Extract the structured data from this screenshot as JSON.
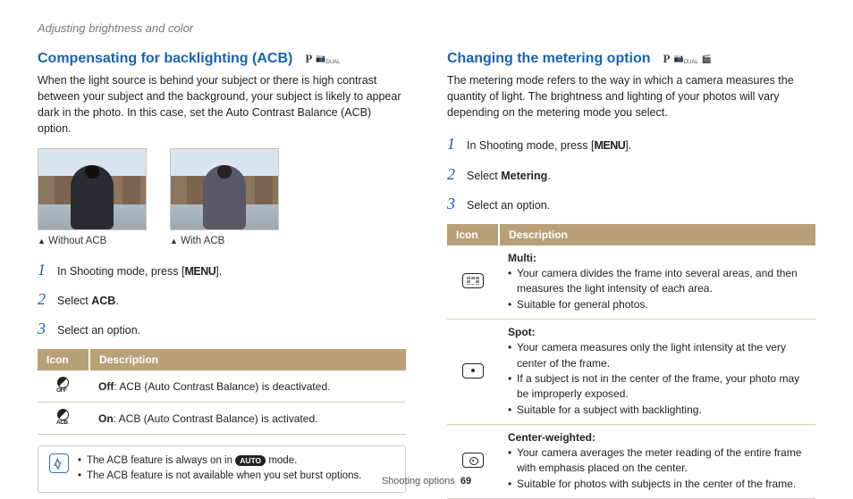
{
  "header": "Adjusting brightness and color",
  "left": {
    "title": "Compensating for backlighting (ACB)",
    "modes": [
      "P",
      "DUAL"
    ],
    "intro": "When the light source is behind your subject or there is high contrast between your subject and the background, your subject is likely to appear dark in the photo. In this case, set the Auto Contrast Balance (ACB) option.",
    "caption1": "Without ACB",
    "caption2": "With ACB",
    "steps": {
      "s1_a": "In Shooting mode, press [",
      "s1_menu": "MENU",
      "s1_b": "].",
      "s2_a": "Select ",
      "s2_b": "ACB",
      "s2_c": ".",
      "s3": "Select an option."
    },
    "table": {
      "h_icon": "Icon",
      "h_desc": "Description",
      "off_b": "Off",
      "off_t": ": ACB (Auto Contrast Balance) is deactivated.",
      "on_b": "On",
      "on_t": ": ACB (Auto Contrast Balance) is activated."
    },
    "note": {
      "l1a": "The ACB feature is always on in ",
      "l1_badge": "AUTO",
      "l1b": " mode.",
      "l2": "The ACB feature is not available when you set burst options."
    }
  },
  "right": {
    "title": "Changing the metering option",
    "modes": [
      "P",
      "DUAL",
      "VIDEO"
    ],
    "intro": "The metering mode refers to the way in which a camera measures the quantity of light. The brightness and lighting of your photos will vary depending on the metering mode you select.",
    "steps": {
      "s1_a": "In Shooting mode, press [",
      "s1_menu": "MENU",
      "s1_b": "].",
      "s2_a": "Select ",
      "s2_b": "Metering",
      "s2_c": ".",
      "s3": "Select an option."
    },
    "table": {
      "h_icon": "Icon",
      "h_desc": "Description",
      "r1_title": "Multi",
      "r1_b1": "Your camera divides the frame into several areas, and then measures the light intensity of each area.",
      "r1_b2": "Suitable for general photos.",
      "r2_title": "Spot",
      "r2_b1": "Your camera measures only the light intensity at the very center of the frame.",
      "r2_b2": "If a subject is not in the center of the frame, your photo may be improperly exposed.",
      "r2_b3": "Suitable for a subject with backlighting.",
      "r3_title": "Center-weighted",
      "r3_b1": "Your camera averages the meter reading of the entire frame with emphasis placed on the center.",
      "r3_b2": "Suitable for photos with subjects in the center of the frame."
    }
  },
  "footer": {
    "section": "Shooting options",
    "page": "69"
  }
}
